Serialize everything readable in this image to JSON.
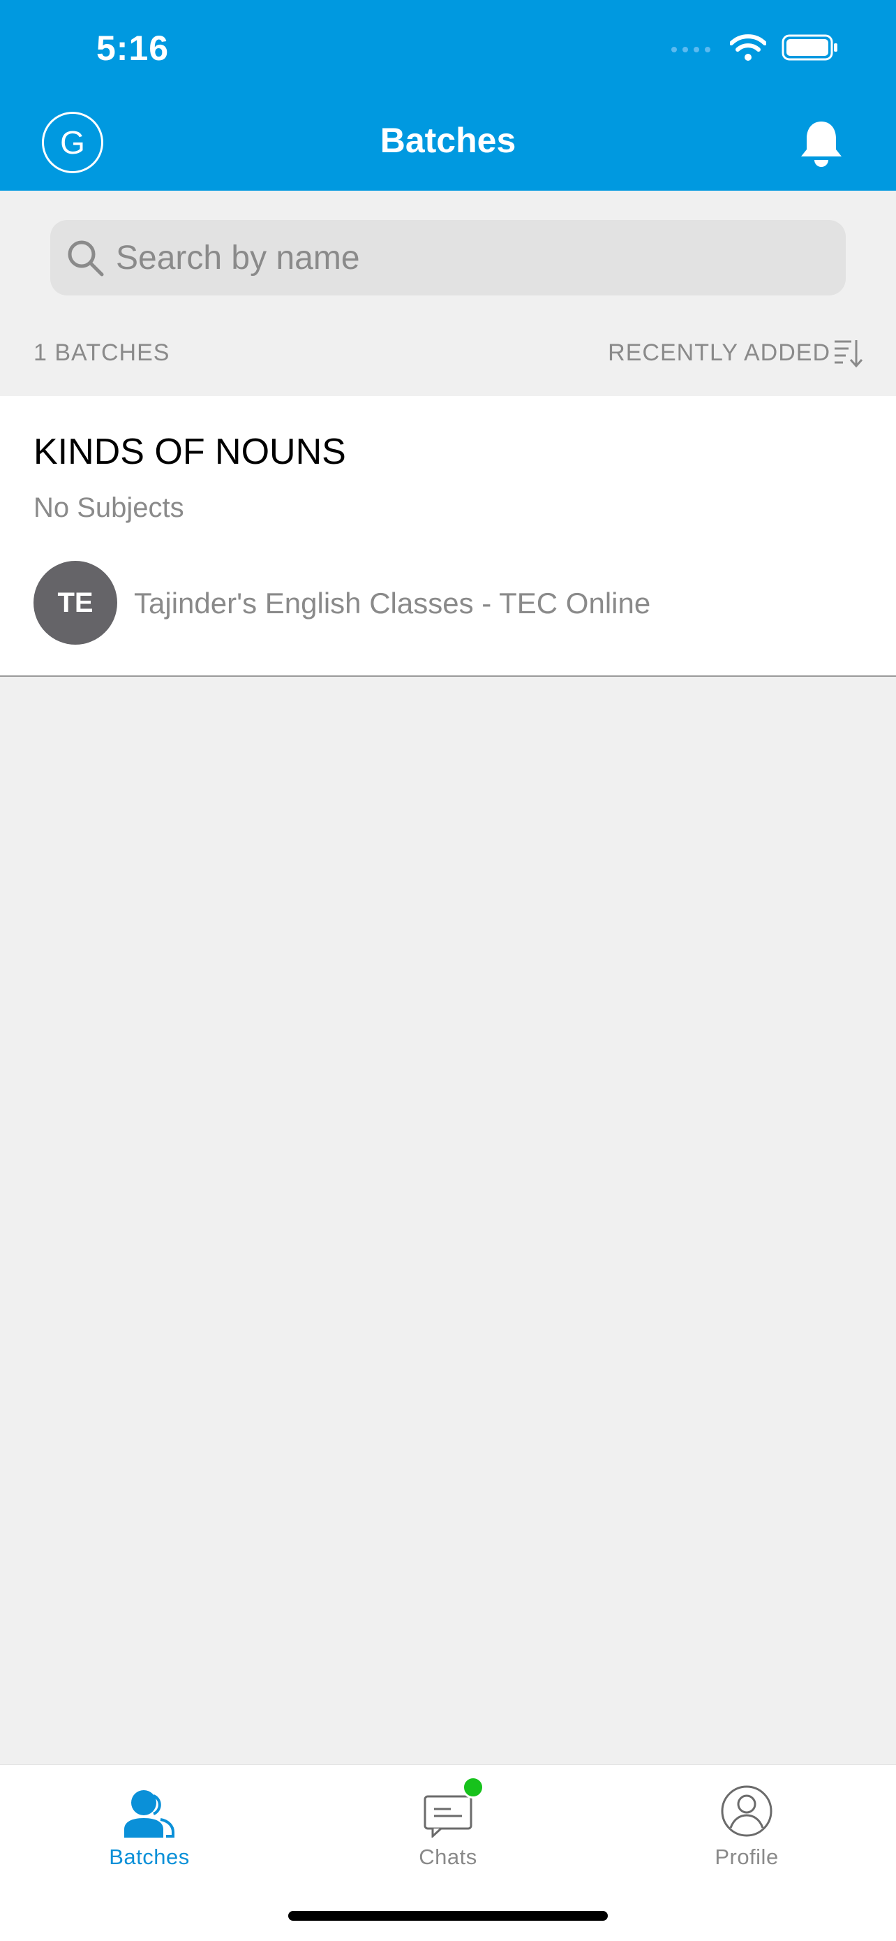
{
  "status_bar": {
    "time": "5:16"
  },
  "header": {
    "avatar_initial": "G",
    "title": "Batches"
  },
  "search": {
    "placeholder": "Search by name",
    "value": ""
  },
  "list_meta": {
    "count_label": "1 BATCHES",
    "sort_label": "RECENTLY ADDED"
  },
  "batches": [
    {
      "title": "KINDS OF NOUNS",
      "subtitle": "No Subjects",
      "org_initials": "TE",
      "org_name": "Tajinder's English Classes - TEC Online"
    }
  ],
  "tabs": [
    {
      "label": "Batches",
      "icon": "batches-icon",
      "active": true
    },
    {
      "label": "Chats",
      "icon": "chat-icon",
      "active": false,
      "badge": true
    },
    {
      "label": "Profile",
      "icon": "profile-icon",
      "active": false
    }
  ],
  "colors": {
    "header_bg": "#0099e0",
    "accent": "#0a90d8",
    "badge": "#17c21c",
    "org_avatar": "#656468"
  }
}
